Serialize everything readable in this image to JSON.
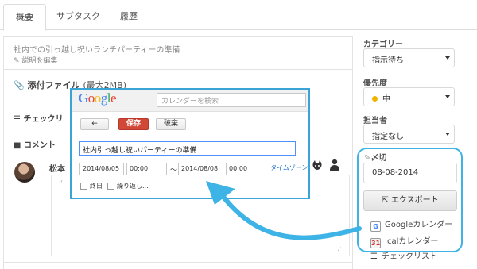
{
  "tabs": [
    {
      "label": "概要"
    },
    {
      "label": "サブタスク"
    },
    {
      "label": "履歴"
    }
  ],
  "task": {
    "title": "社内での引っ越し祝いランチパーティーの準備",
    "edit_description": "説明を編集"
  },
  "attachments": {
    "label": "添付ファイル",
    "limit": "(最大2MB)"
  },
  "checklist": {
    "label": "チェックリ"
  },
  "comments": {
    "label": "コメント",
    "author": "松本"
  },
  "sidebar": {
    "category_label": "カテゴリー",
    "category_value": "指示待ち",
    "priority_label": "優先度",
    "priority_value": "中",
    "assignee_label": "担当者",
    "assignee_value": "指定なし",
    "due_label": "〆切",
    "due_value": "08-08-2014",
    "export_label": "エクスポート",
    "export_menu": [
      {
        "label": "Googleカレンダー",
        "icon": "google-calendar-icon"
      },
      {
        "label": "Icalカレンダー",
        "icon": "ical-calendar-icon"
      },
      {
        "label": "チェックリスト",
        "icon": "checklist-icon"
      }
    ]
  },
  "google_popup": {
    "logo_letters": [
      "G",
      "o",
      "o",
      "g",
      "l",
      "e"
    ],
    "logo_colors": [
      "#4285f4",
      "#ea4335",
      "#fbbc05",
      "#4285f4",
      "#34a853",
      "#ea4335"
    ],
    "search_placeholder": "カレンダーを検索",
    "back_label": "←",
    "save_label": "保存",
    "discard_label": "破棄",
    "event_title": "社内引っ越し祝いパーティーの準備",
    "start_date": "2014/08/05",
    "start_time": "00:00",
    "range_separator": "～",
    "end_date": "2014/08/08",
    "end_time": "00:00",
    "timezone_link": "タイムゾーン",
    "all_day_label": "終日",
    "repeat_label": "繰り返し..."
  },
  "colors": {
    "accent_blue": "#3eb3e6",
    "save_red": "#d14836",
    "priority_dot": "#f0b400"
  }
}
